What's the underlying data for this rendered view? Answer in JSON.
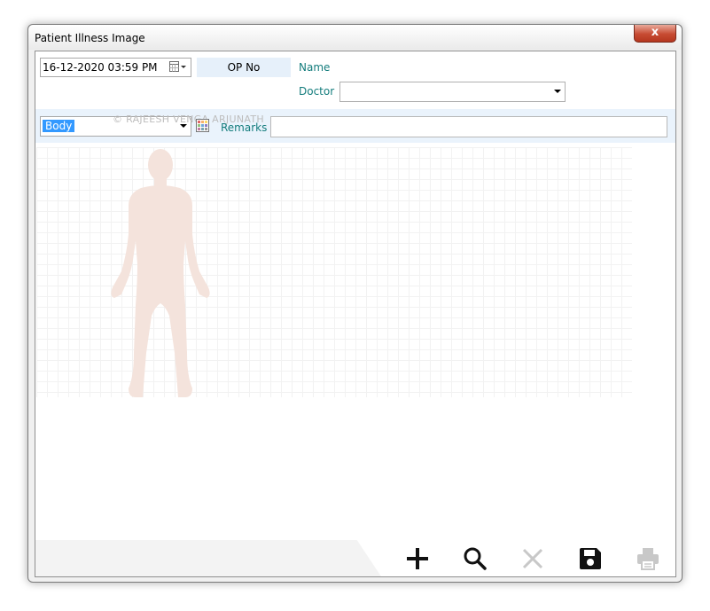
{
  "window": {
    "title": "Patient Illness Image",
    "close_glyph": "x"
  },
  "header": {
    "date_value": "16-12-2020 03:59 PM",
    "op_label": "OP No",
    "name_label": "Name",
    "doctor_label": "Doctor",
    "doctor_value": ""
  },
  "image_controls": {
    "image_type_value": "Body",
    "watermark": "© RAJEESH VENGA ARJUNATH",
    "remarks_label": "Remarks",
    "remarks_value": ""
  },
  "toolbar": {
    "items": [
      {
        "name": "add",
        "icon": "plus-icon",
        "enabled": true
      },
      {
        "name": "search",
        "icon": "magnifier-icon",
        "enabled": true
      },
      {
        "name": "delete",
        "icon": "x-icon",
        "enabled": false
      },
      {
        "name": "save",
        "icon": "floppy-disk-icon",
        "enabled": true
      },
      {
        "name": "print",
        "icon": "printer-icon",
        "enabled": false
      }
    ]
  },
  "colors": {
    "teal_label": "#137c7c",
    "band_blue": "#eaf3fc",
    "body_silhouette": "#f4e3dc",
    "disabled_icon": "#c8c8c8"
  }
}
